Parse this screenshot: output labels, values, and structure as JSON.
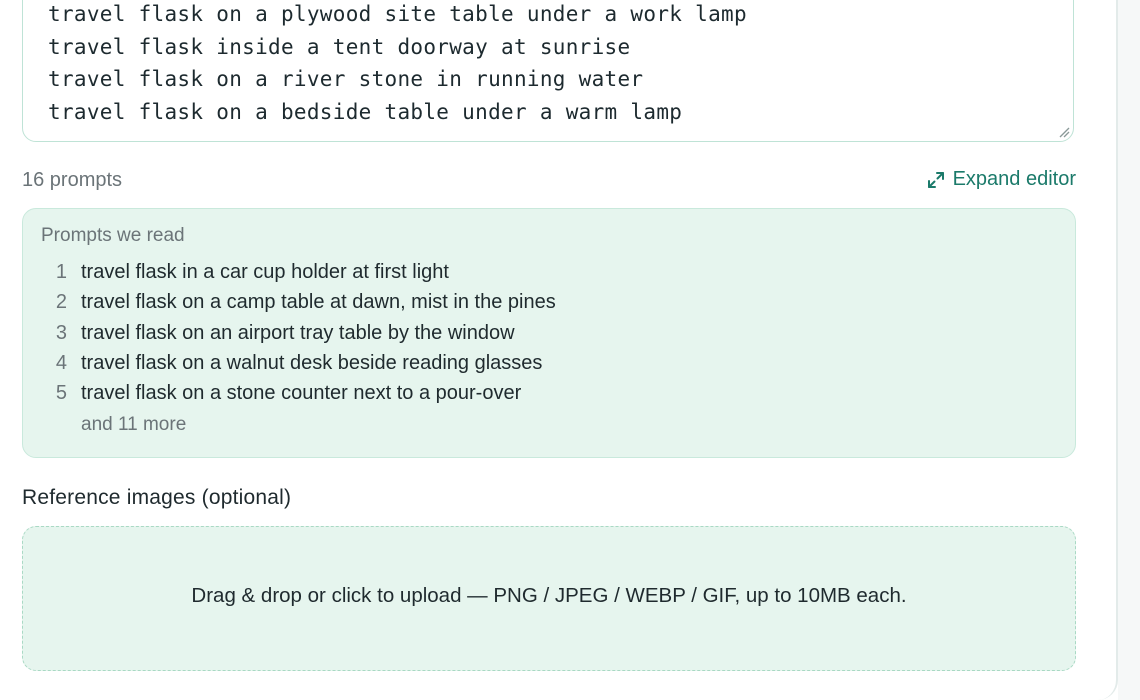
{
  "editor": {
    "visible_lines": [
      "travel flask on a plywood site table under a work lamp",
      "travel flask inside a tent doorway at sunrise",
      "travel flask on a river stone in running water",
      "travel flask on a bedside table under a warm lamp"
    ]
  },
  "meta": {
    "prompt_count": "16 prompts",
    "expand_label": "Expand editor",
    "expand_icon": "expand-arrows-icon"
  },
  "read_box": {
    "title": "Prompts we read",
    "items": [
      {
        "num": "1",
        "text": "travel flask in a car cup holder at first light"
      },
      {
        "num": "2",
        "text": "travel flask on a camp table at dawn, mist in the pines"
      },
      {
        "num": "3",
        "text": "travel flask on an airport tray table by the window"
      },
      {
        "num": "4",
        "text": "travel flask on a walnut desk beside reading glasses"
      },
      {
        "num": "5",
        "text": "travel flask on a stone counter next to a pour-over"
      }
    ],
    "more": "and 11 more"
  },
  "reference": {
    "label": "Reference images (optional)",
    "dropzone_text": "Drag & drop or click to upload — PNG / JPEG / WEBP / GIF, up to 10MB each."
  },
  "colors": {
    "accent": "#1b7a6a",
    "panel_bg": "#e6f5ee",
    "border": "#c9e9dc"
  }
}
